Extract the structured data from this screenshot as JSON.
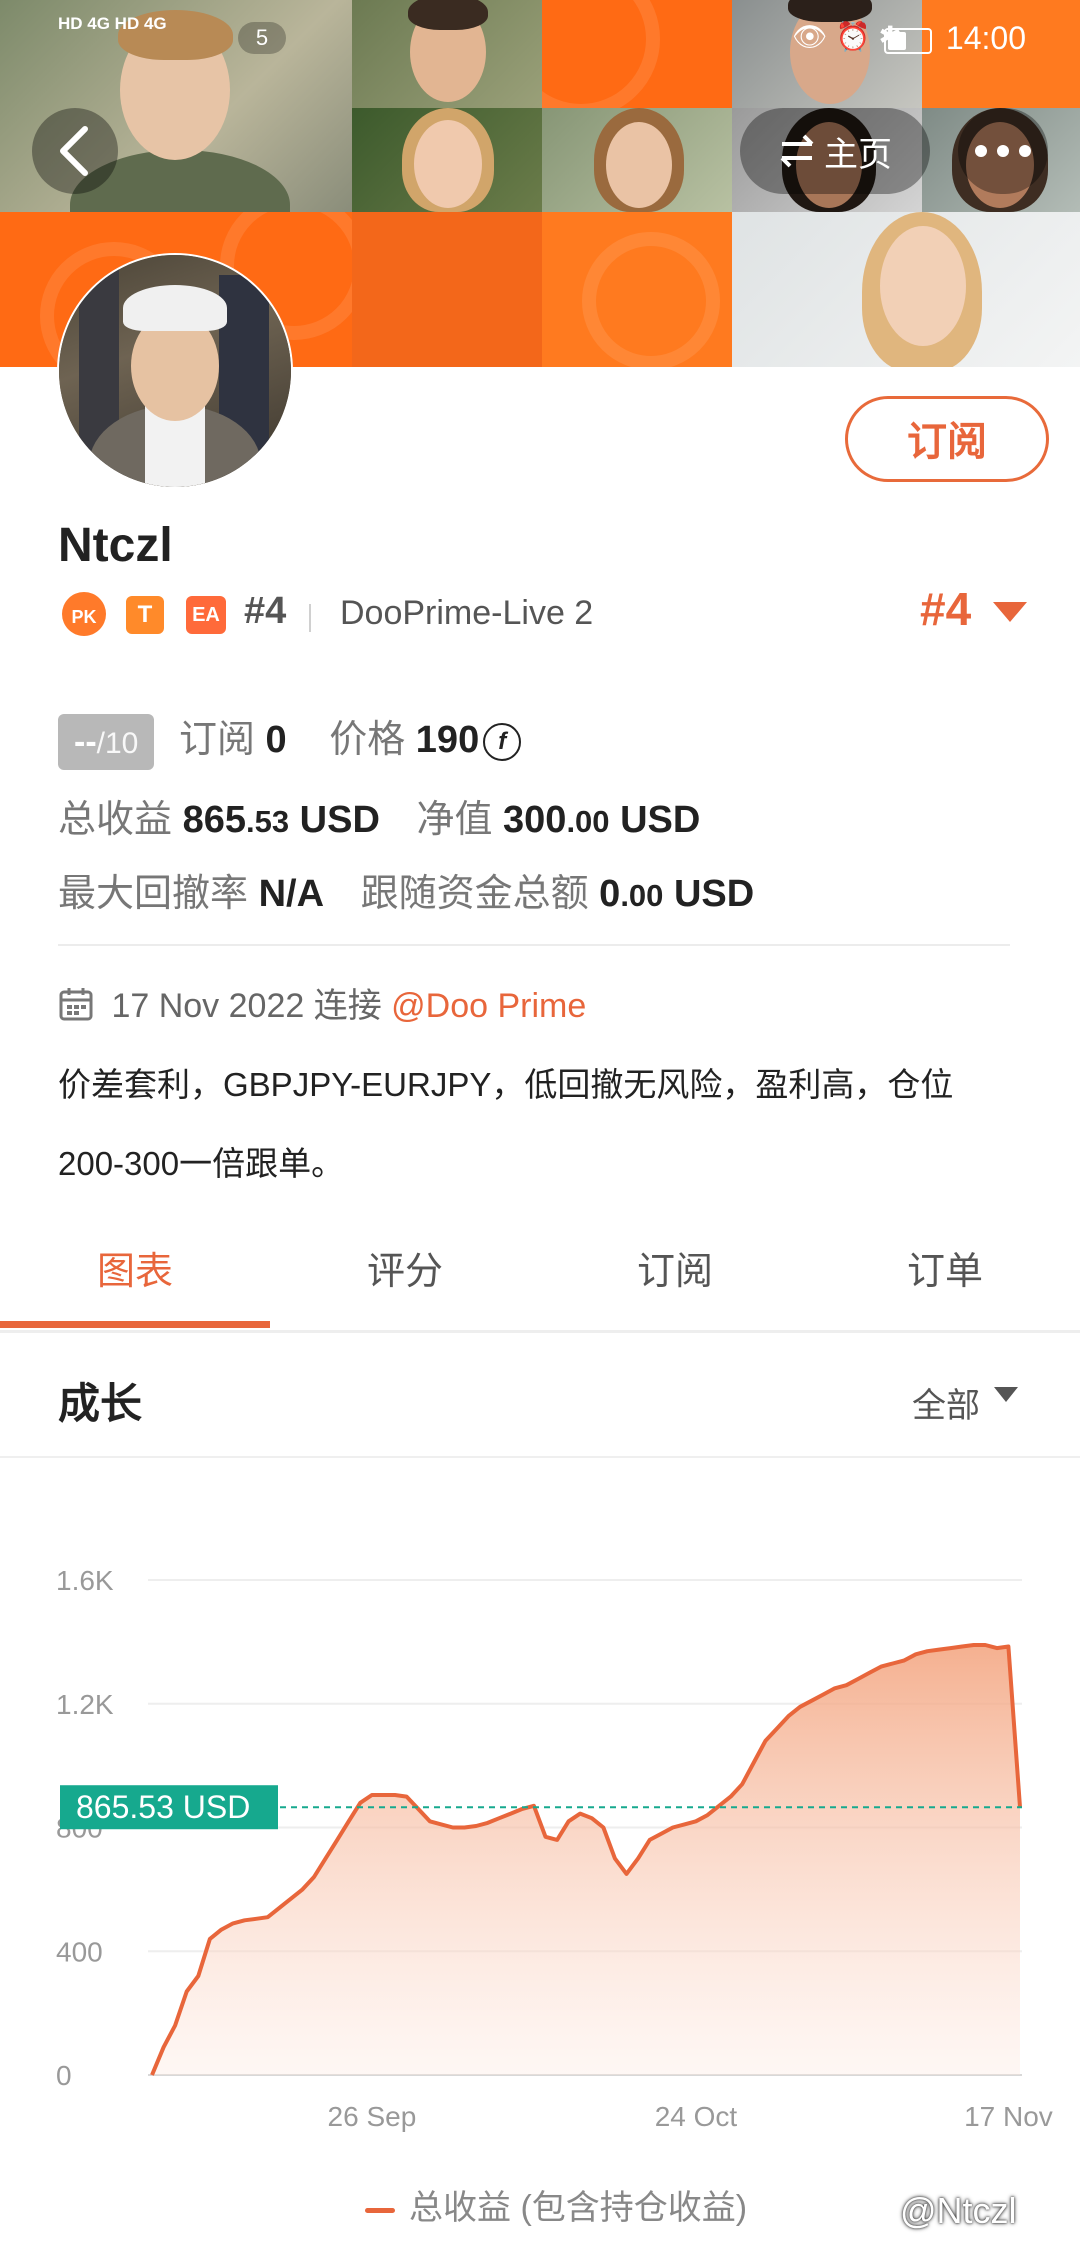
{
  "status_bar": {
    "network": "HD 4G  HD 4G",
    "notification_count": "5",
    "time": "14:00",
    "icons": [
      "eye-icon",
      "alarm-icon",
      "bluetooth-icon",
      "battery-icon"
    ]
  },
  "header": {
    "back_icon": "chevron-left-icon",
    "home_button_label": "主页",
    "home_icon": "swap-icon",
    "more_icon": "more-dots-icon"
  },
  "profile": {
    "username": "Ntczl",
    "subscribe_label": "订阅",
    "tags": [
      "PK",
      "T",
      "EA"
    ],
    "rank_small": "#4",
    "server": "DooPrime-Live 2",
    "rank_big": "#4",
    "rating": {
      "value": "--",
      "max": "/10"
    },
    "subscribers_label": "订阅",
    "subscribers_value": "0",
    "price_label": "价格",
    "price_value": "190",
    "price_coin_symbol": "f",
    "total_profit_label": "总收益",
    "total_profit_int": "865",
    "total_profit_dec": ".53",
    "total_profit_unit": "USD",
    "equity_label": "净值",
    "equity_int": "300",
    "equity_dec": ".00",
    "equity_unit": "USD",
    "max_drawdown_label": "最大回撤率",
    "max_drawdown_value": "N/A",
    "follow_funds_label": "跟随资金总额",
    "follow_funds_int": "0",
    "follow_funds_dec": ".00",
    "follow_funds_unit": "USD",
    "connected_date": "17 Nov 2022",
    "connected_label": "连接",
    "broker_link": "@Doo Prime",
    "description_line1": "价差套利，GBPJPY-EURJPY，低回撤无风险，盈利高，仓位",
    "description_line2": "200-300一倍跟单。"
  },
  "tabs": [
    "图表",
    "评分",
    "订阅",
    "订单"
  ],
  "active_tab": 0,
  "growth": {
    "title": "成长",
    "range_label": "全部"
  },
  "chart_data": {
    "type": "area",
    "title": "",
    "ylim": [
      0,
      1600
    ],
    "y_ticks": [
      "0",
      "400",
      "800",
      "1.2K",
      "1.6K"
    ],
    "y_tick_values": [
      0,
      400,
      800,
      1200,
      1600
    ],
    "x_ticks": [
      "26 Sep",
      "24 Oct",
      "17 Nov"
    ],
    "x_tick_positions": [
      19,
      47,
      74
    ],
    "series": [
      {
        "name": "总收益 (包含持仓收益)",
        "color": "#e8663b",
        "x_day": [
          0,
          1,
          2,
          3,
          4,
          5,
          6,
          7,
          8,
          9,
          10,
          11,
          12,
          13,
          14,
          15,
          16,
          17,
          18,
          19,
          20,
          21,
          22,
          23,
          24,
          25,
          26,
          27,
          28,
          29,
          30,
          31,
          32,
          33,
          34,
          35,
          36,
          37,
          38,
          39,
          40,
          41,
          42,
          43,
          44,
          45,
          46,
          47,
          48,
          49,
          50,
          51,
          52,
          53,
          54,
          55,
          56,
          57,
          58,
          59,
          60,
          61,
          62,
          63,
          64,
          65,
          66,
          67,
          68,
          69,
          70,
          71,
          72,
          73,
          74,
          75
        ],
        "values": [
          0,
          90,
          160,
          270,
          320,
          440,
          470,
          490,
          500,
          505,
          510,
          540,
          570,
          600,
          640,
          700,
          760,
          820,
          880,
          905,
          905,
          905,
          900,
          860,
          820,
          810,
          800,
          800,
          805,
          815,
          830,
          845,
          860,
          870,
          770,
          760,
          820,
          845,
          830,
          800,
          700,
          650,
          700,
          760,
          780,
          800,
          810,
          820,
          840,
          870,
          900,
          940,
          1010,
          1080,
          1120,
          1160,
          1190,
          1210,
          1230,
          1250,
          1260,
          1280,
          1300,
          1320,
          1330,
          1340,
          1360,
          1370,
          1375,
          1380,
          1385,
          1390,
          1390,
          1380,
          1385,
          865.53
        ]
      }
    ],
    "current_value": 865.53,
    "current_label": "865.53 USD",
    "current_label_color": "#16a98e",
    "legend": "总收益 (包含持仓收益)",
    "grid": true,
    "legend_position": "bottom"
  },
  "watermark": "@Ntczl",
  "colors": {
    "accent": "#e8663b",
    "banner_orange": "#ff6a14",
    "badge_green": "#16a98e",
    "rating_gray": "#b8b8b8"
  }
}
